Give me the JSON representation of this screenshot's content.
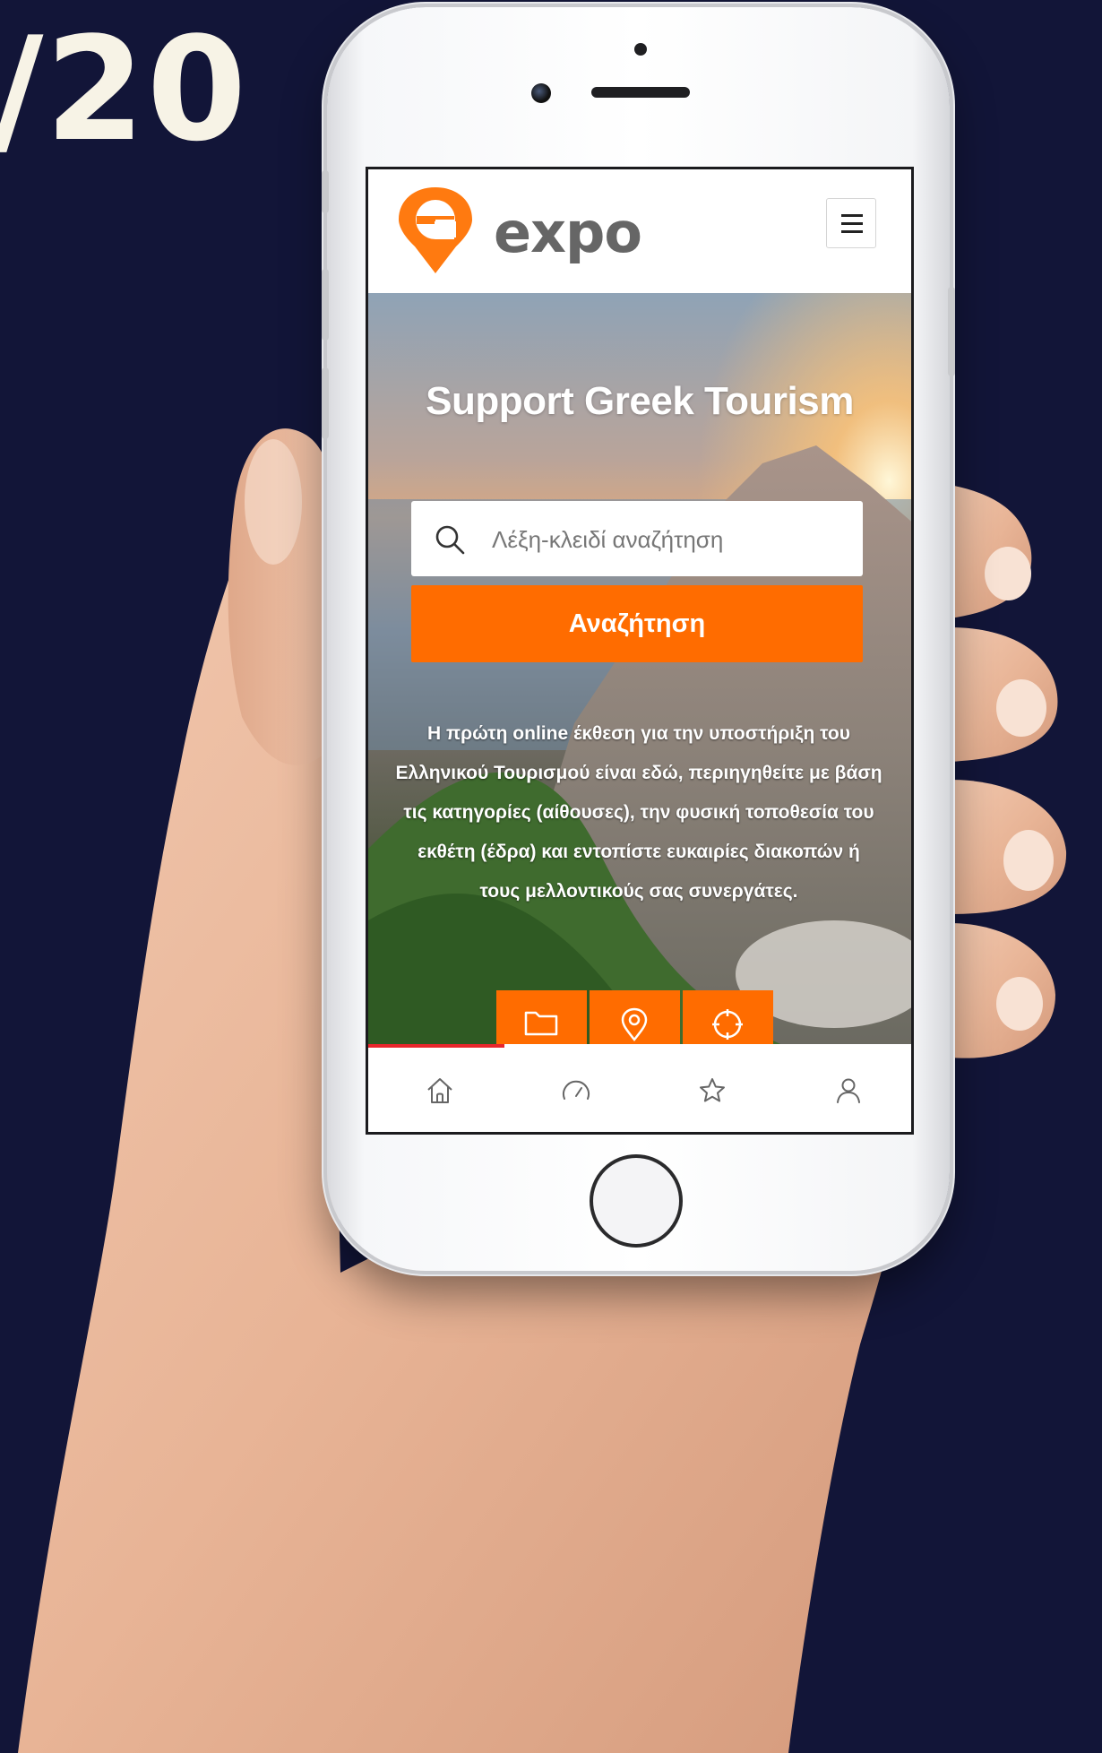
{
  "overlay": {
    "corner_text": "/20"
  },
  "app": {
    "logo_text": "expo",
    "accent_color": "#ff6c00",
    "menu_icon": "hamburger-icon"
  },
  "hero": {
    "title": "Support Greek Tourism",
    "search_placeholder": "Λέξη-κλειδί αναζήτηση",
    "search_button_label": "Αναζήτηση",
    "description": "Η πρώτη online έκθεση για την υποστήριξη του Ελληνικού Τουρισμού είναι εδώ, περιηγηθείτε με βάση τις κατηγορίες (αίθουσες), την φυσική τοποθεσία του εκθέτη (έδρα) και εντοπίστε ευκαιρίες διακοπών ή τους μελλοντικούς σας συνεργάτες."
  },
  "quick_buttons": [
    {
      "icon": "folder-icon"
    },
    {
      "icon": "location-pin-icon"
    },
    {
      "icon": "crosshair-icon"
    }
  ],
  "bottom_nav": [
    {
      "icon": "home-icon"
    },
    {
      "icon": "speedometer-icon"
    },
    {
      "icon": "star-icon"
    },
    {
      "icon": "user-icon"
    }
  ]
}
